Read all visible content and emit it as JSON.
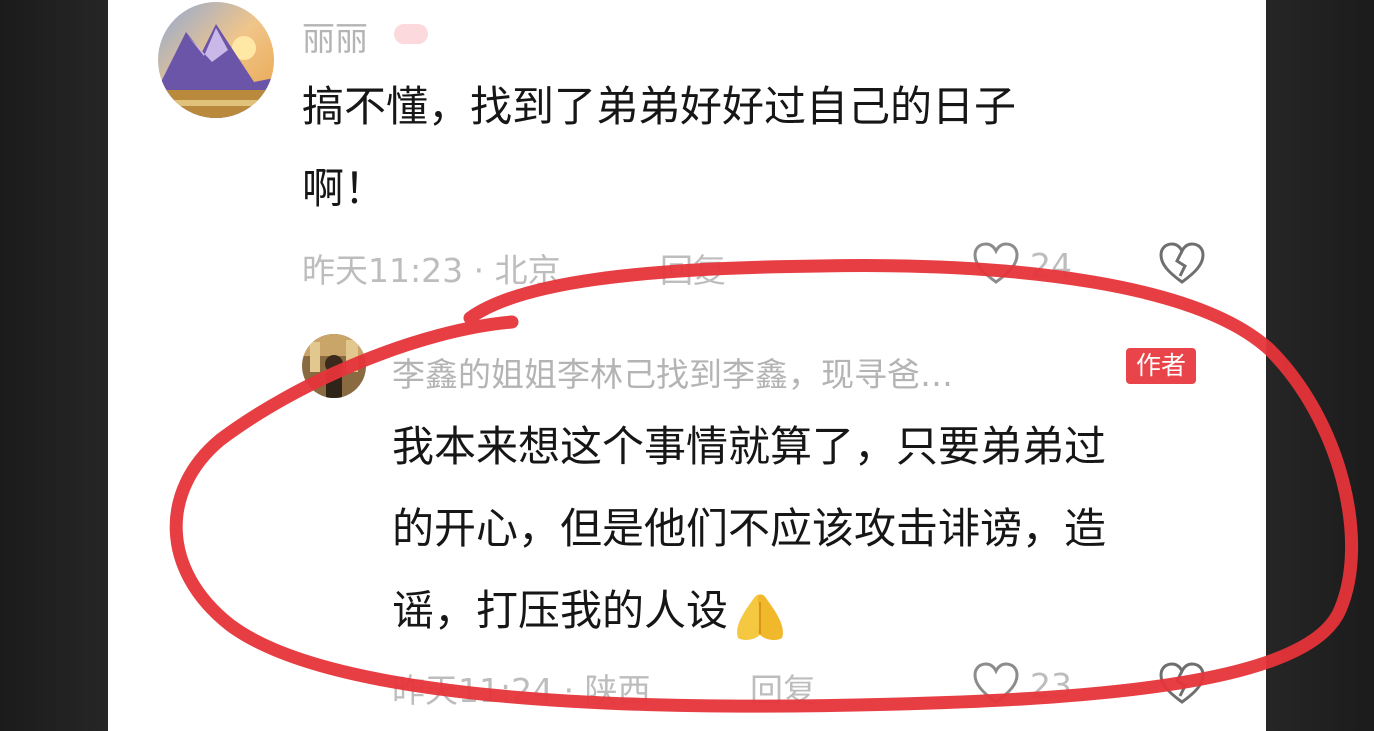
{
  "comment1": {
    "username": "丽丽",
    "text_line1": "搞不懂，找到了弟弟好好过自己的日子",
    "text_line2": "啊！",
    "time_location": "昨天11:23 · 北京",
    "reply_label": "回复",
    "like_count": "24"
  },
  "comment2": {
    "username": "李鑫的姐姐李林己找到李鑫，现寻爸…",
    "author_badge": "作者",
    "text_line1": "我本来想这个事情就算了，只要弟弟过",
    "text_line2": "的开心，但是他们不应该攻击诽谤，造",
    "text_line3": "谣，打压我的人设",
    "time_location": "昨天11:24 · 陕西",
    "reply_label": "回复",
    "like_count": "23"
  },
  "colors": {
    "annotation_circle": "#e6343a",
    "author_badge": "#e8444a"
  },
  "icons": [
    "heart-icon",
    "broken-heart-icon",
    "clasped-hands-emoji"
  ]
}
